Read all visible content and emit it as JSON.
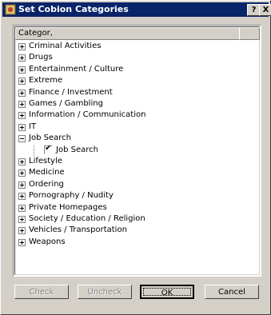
{
  "window": {
    "title": "Set Cobion Categories",
    "help_button": "?",
    "close_button": "X"
  },
  "list": {
    "column_header": "Categor,",
    "categories": [
      {
        "label": "Criminal Activities"
      },
      {
        "label": "Drugs"
      },
      {
        "label": "Entertainment / Culture"
      },
      {
        "label": "Extreme"
      },
      {
        "label": "Finance / Investment"
      },
      {
        "label": "Games / Gambling"
      },
      {
        "label": "Information / Communication"
      },
      {
        "label": "IT"
      },
      {
        "label": "Job Search",
        "expanded": true,
        "children": [
          {
            "label": "Job Search",
            "checked": true
          }
        ]
      },
      {
        "label": "Lifestyle"
      },
      {
        "label": "Medicine"
      },
      {
        "label": "Ordering"
      },
      {
        "label": "Pornography / Nudity"
      },
      {
        "label": "Private Homepages"
      },
      {
        "label": "Society / Education / Religion"
      },
      {
        "label": "Vehicles / Transportation"
      },
      {
        "label": "Weapons"
      }
    ]
  },
  "buttons": {
    "check": "Check",
    "uncheck": "Uncheck",
    "ok": "OK",
    "cancel": "Cancel"
  },
  "colors": {
    "titlebar": "#0a246a",
    "face": "#d4d0c8"
  }
}
